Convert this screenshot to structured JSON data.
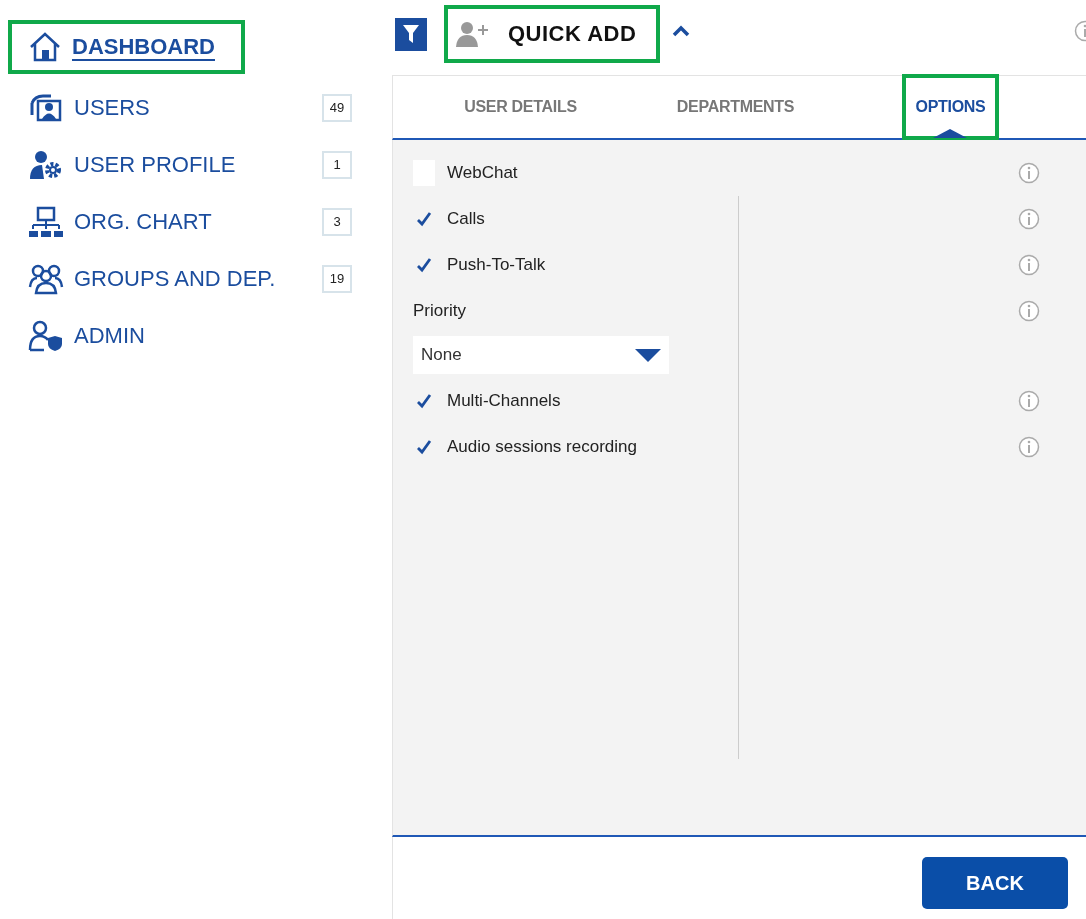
{
  "sidebar": {
    "items": [
      {
        "label": "DASHBOARD",
        "selected": true,
        "highlighted": true
      },
      {
        "label": "USERS",
        "badge": "49",
        "selected": false,
        "highlighted": false
      },
      {
        "label": "USER PROFILE",
        "badge": "1",
        "selected": false,
        "highlighted": false
      },
      {
        "label": "ORG. CHART",
        "badge": "3",
        "selected": false,
        "highlighted": false
      },
      {
        "label": "GROUPS AND DEP.",
        "badge": "19",
        "selected": false,
        "highlighted": false
      },
      {
        "label": "ADMIN",
        "selected": false,
        "highlighted": false
      }
    ]
  },
  "header": {
    "title": "QUICK ADD",
    "highlighted": true,
    "expanded": true
  },
  "tabs": [
    {
      "label": "USER DETAILS",
      "selected": false,
      "highlighted": false
    },
    {
      "label": "DEPARTMENTS",
      "selected": false,
      "highlighted": false
    },
    {
      "label": "OPTIONS",
      "selected": true,
      "highlighted": true
    }
  ],
  "options": [
    {
      "kind": "checkbox",
      "label": "WebChat",
      "checked": false
    },
    {
      "kind": "checkbox",
      "label": "Calls",
      "checked": true
    },
    {
      "kind": "checkbox",
      "label": "Push-To-Talk",
      "checked": true
    },
    {
      "kind": "select",
      "label": "Priority",
      "value": "None"
    },
    {
      "kind": "checkbox",
      "label": "Multi-Channels",
      "checked": true
    },
    {
      "kind": "checkbox",
      "label": "Audio sessions recording",
      "checked": true
    }
  ],
  "buttons": [
    {
      "label": "BACK"
    }
  ]
}
